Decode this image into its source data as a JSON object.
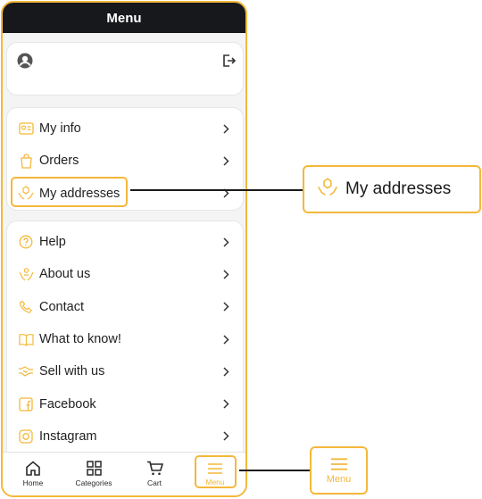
{
  "header": {
    "title": "Menu"
  },
  "profile": {
    "avatar_icon": "user-icon",
    "logout_icon": "logout-icon"
  },
  "account_section": {
    "items": [
      {
        "label": "My info",
        "icon": "id-card-icon"
      },
      {
        "label": "Orders",
        "icon": "shopping-bag-icon"
      },
      {
        "label": "My addresses",
        "icon": "hands-box-icon",
        "highlighted": true
      }
    ]
  },
  "info_section": {
    "items": [
      {
        "label": "Help",
        "icon": "help-circle-icon"
      },
      {
        "label": "About us",
        "icon": "about-us-icon"
      },
      {
        "label": "Contact",
        "icon": "phone-icon"
      },
      {
        "label": "What to know!",
        "icon": "book-icon"
      },
      {
        "label": "Sell with us",
        "icon": "handshake-icon"
      },
      {
        "label": "Facebook",
        "icon": "facebook-icon"
      },
      {
        "label": "Instagram",
        "icon": "instagram-icon"
      }
    ]
  },
  "tabbar": {
    "items": [
      {
        "label": "Home",
        "icon": "home-icon"
      },
      {
        "label": "Categories",
        "icon": "grid-icon"
      },
      {
        "label": "Cart",
        "icon": "cart-icon"
      },
      {
        "label": "Menu",
        "icon": "hamburger-icon",
        "active": true
      }
    ]
  },
  "callouts": {
    "addresses": {
      "label": "My addresses",
      "icon": "hands-box-icon"
    },
    "menu_tab": {
      "label": "Menu",
      "icon": "hamburger-icon"
    }
  },
  "colors": {
    "accent": "#f4b83a",
    "topbar": "#17181c",
    "background": "#f4f4f4"
  }
}
